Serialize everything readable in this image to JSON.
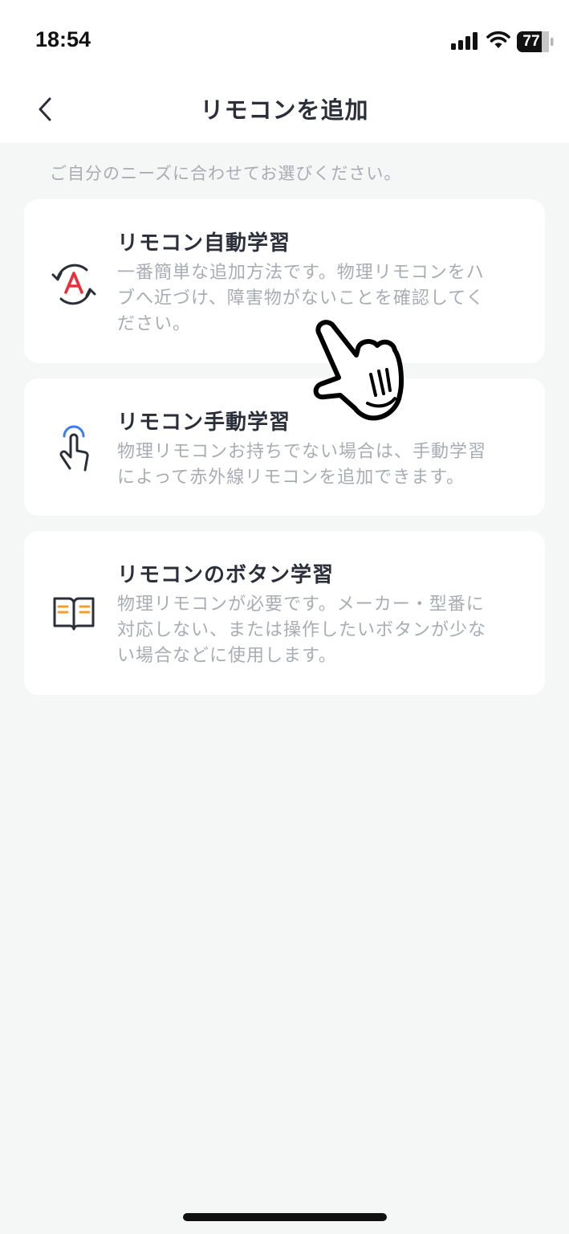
{
  "status_bar": {
    "time": "18:54",
    "battery": "77",
    "signal_icon": "cellular-signal-icon",
    "wifi_icon": "wifi-icon",
    "battery_icon": "battery-icon"
  },
  "header": {
    "title": "リモコンを追加",
    "back_icon": "chevron-left-icon"
  },
  "subtitle": "ご自分のニーズに合わせてお選びください。",
  "options": [
    {
      "title": "リモコン自動学習",
      "desc_lines": [
        "一番簡単な追加方法です。物理リモコンをハ",
        "ブへ近づけ、障害物がないことを確認してく",
        "ださい。"
      ],
      "icon": "auto-learn-icon"
    },
    {
      "title": "リモコン手動学習",
      "desc_lines": [
        "物理リモコンお持ちでない場合は、手動学習",
        "によって赤外線リモコンを追加できます。"
      ],
      "icon": "finger-touch-icon"
    },
    {
      "title": "リモコンのボタン学習",
      "desc_lines": [
        "物理リモコンが必要です。メーカー・型番に",
        "対応しない、または操作したいボタンが少な",
        "い場合などに使用します。"
      ],
      "icon": "open-book-icon"
    }
  ],
  "colors": {
    "background": "#f5f7f6",
    "card": "#ffffff",
    "title_text": "#2b2f3a",
    "secondary_text": "#a8acb3",
    "accent_red": "#e8303a",
    "accent_blue": "#3b7cf0",
    "accent_orange": "#f2a22c"
  }
}
